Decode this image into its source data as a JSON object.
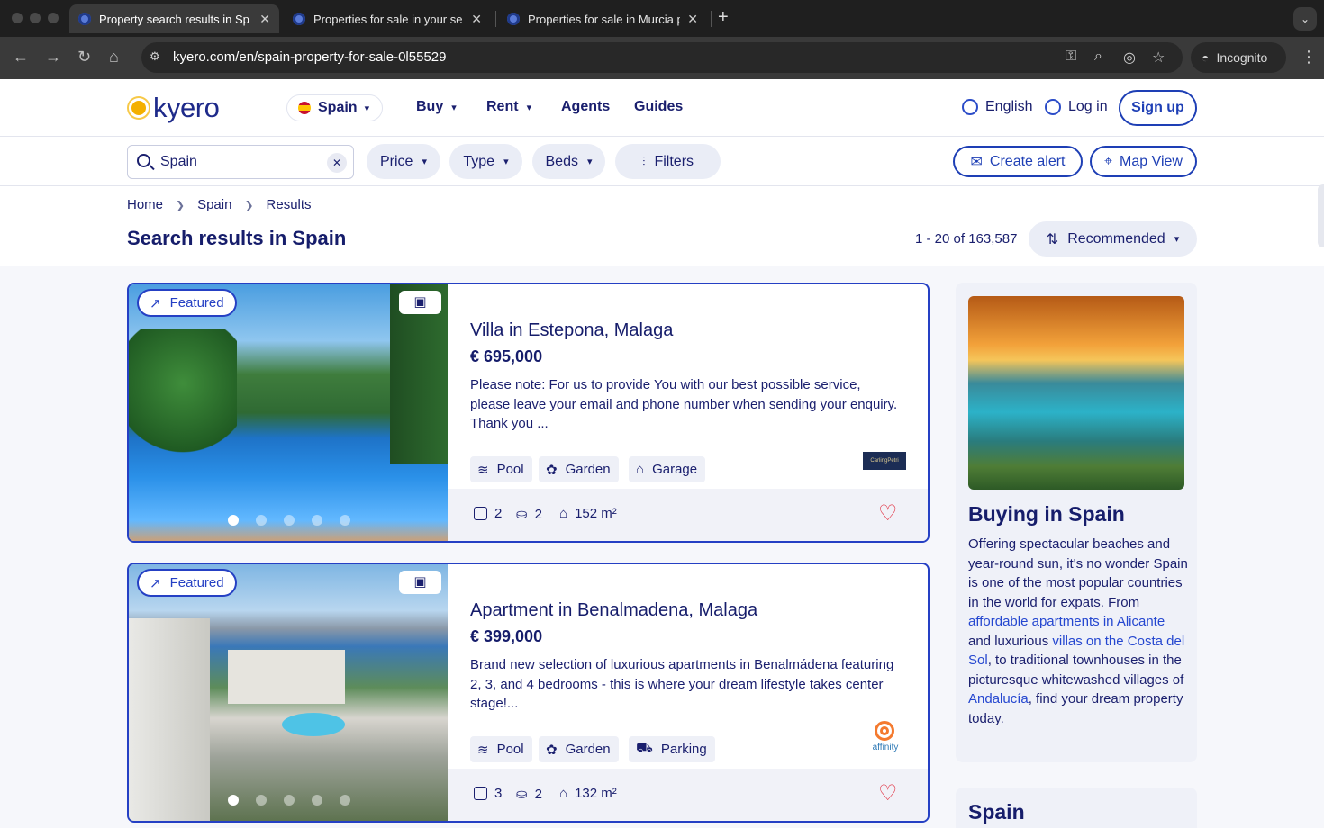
{
  "browser": {
    "tabs": [
      {
        "title": "Property search results in Sp",
        "active": true
      },
      {
        "title": "Properties for sale in your se",
        "active": false
      },
      {
        "title": "Properties for sale in Murcia p",
        "active": false
      }
    ],
    "url": "kyero.com/en/spain-property-for-sale-0l55529",
    "incognito_label": "Incognito"
  },
  "header": {
    "logo_text": "kyero",
    "country": "Spain",
    "nav": [
      "Buy",
      "Rent",
      "Agents",
      "Guides"
    ],
    "language": "English",
    "login": "Log in",
    "signup": "Sign up"
  },
  "filters": {
    "search_value": "Spain",
    "pills": [
      "Price",
      "Type",
      "Beds",
      "Filters"
    ],
    "create_alert": "Create alert",
    "map_view": "Map View"
  },
  "breadcrumb": [
    "Home",
    "Spain",
    "Results"
  ],
  "page_title": "Search results in Spain",
  "result_count": "1 - 20 of 163,587",
  "sort_label": "Recommended",
  "listings": [
    {
      "badge": "Featured",
      "title": "Villa in Estepona, Malaga",
      "price": "€ 695,000",
      "description": "Please note: For us to provide You with our best possible service, please leave your email and phone number when sending your enquiry. Thank you ...",
      "features": [
        "Pool",
        "Garden",
        "Garage"
      ],
      "beds": "2",
      "baths": "2",
      "area": "152 m²",
      "agent_logo_text": "CarlingPetri"
    },
    {
      "badge": "Featured",
      "title": "Apartment in Benalmadena, Malaga",
      "price": "€ 399,000",
      "description": "Brand new selection of luxurious apartments in Benalmádena featuring 2, 3, and 4 bedrooms - this is where your dream lifestyle takes center stage!...",
      "features": [
        "Pool",
        "Garden",
        "Parking"
      ],
      "beds": "3",
      "baths": "2",
      "area": "132 m²",
      "agent_logo_text": "affinity"
    }
  ],
  "sidebar": {
    "title": "Buying in Spain",
    "text_1": "Offering spectacular beaches and year-round sun, it's no wonder Spain is one of the most popular countries in the world for expats. From ",
    "link_1": "affordable apartments in Alicante",
    "text_2": " and luxurious ",
    "link_2": "villas on the Costa del Sol",
    "text_3": ", to traditional townhouses in the picturesque whitewashed villages of ",
    "link_3": "Andalucía",
    "text_4": ", find your dream property today.",
    "second_title": "Spain"
  },
  "colors": {
    "brand_blue": "#2540c4",
    "navy_text": "#161d6b",
    "heart_red": "#e12b3c",
    "logo_yellow": "#f4b000"
  }
}
